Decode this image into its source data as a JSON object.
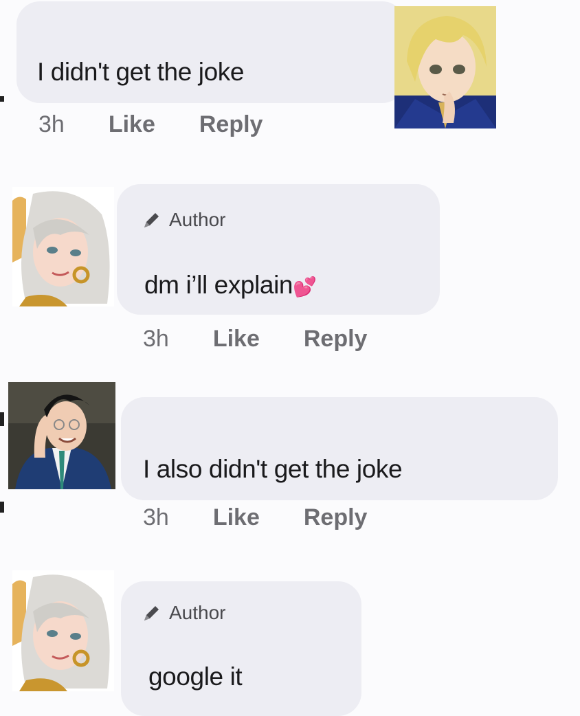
{
  "comments": [
    {
      "id": "c1",
      "author_badge": "",
      "text": "I didn't get the joke",
      "time": "3h",
      "like_label": "Like",
      "reply_label": "Reply",
      "avatar": "blonde-character-avatar"
    },
    {
      "id": "c2",
      "author_badge": "Author",
      "text": "dm i’ll explain",
      "emoji": "💕",
      "time": "3h",
      "like_label": "Like",
      "reply_label": "Reply",
      "avatar": "silver-hair-character-avatar"
    },
    {
      "id": "c3",
      "author_badge": "",
      "text": "I also didn't get the joke",
      "time": "3h",
      "like_label": "Like",
      "reply_label": "Reply",
      "avatar": "suit-glasses-character-avatar"
    },
    {
      "id": "c4",
      "author_badge": "Author",
      "text": "google it",
      "avatar": "silver-hair-character-avatar"
    }
  ],
  "colors": {
    "bubble": "#ededf3",
    "meta_text": "#6d6d72",
    "body_text": "#1a1a1c"
  },
  "icons": {
    "author_badge": "pencil-icon"
  }
}
